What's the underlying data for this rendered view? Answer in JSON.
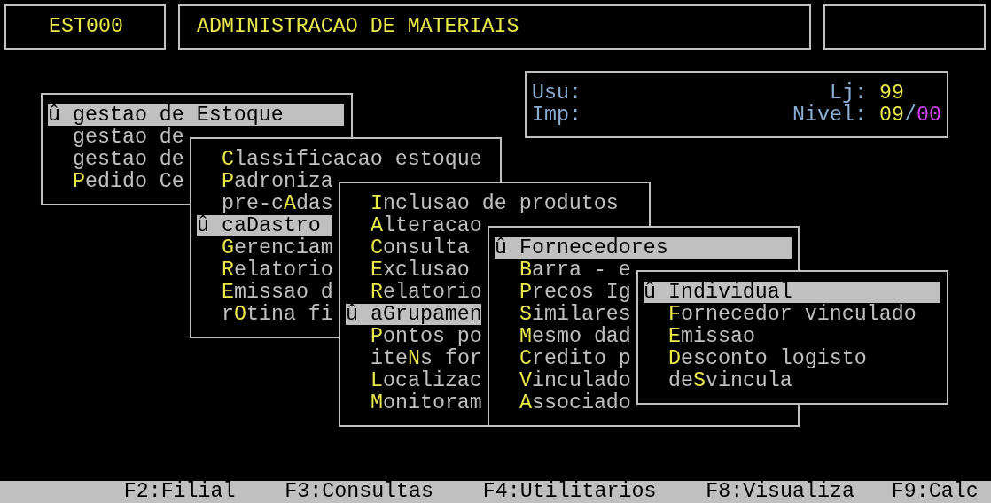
{
  "header": {
    "program_code": "EST000",
    "title": "ADMINISTRACAO DE MATERIAIS"
  },
  "info": {
    "rows": [
      {
        "label": "Usu:",
        "side_label": "Lj:",
        "value": [
          {
            "text": "99",
            "color": "#e8e84a"
          }
        ]
      },
      {
        "label": "Imp:",
        "side_label": "Nivel:",
        "value": [
          {
            "text": "09",
            "color": "#e8e84a"
          },
          {
            "text": "/",
            "color": "#8aaed6"
          },
          {
            "text": "00",
            "color": "#d040f0"
          }
        ]
      }
    ]
  },
  "menus": [
    {
      "items": [
        {
          "label": "gestao de Estoque",
          "selected": true,
          "marker": "û"
        },
        {
          "label": "gestao de",
          "selected": false
        },
        {
          "label": "gestao de",
          "selected": false
        },
        {
          "label": "**P**edido Ce",
          "selected": false
        }
      ]
    },
    {
      "items": [
        {
          "label": "**C**lassificacao estoque",
          "selected": false
        },
        {
          "label": "**P**adroniza",
          "selected": false
        },
        {
          "label": "pre-c**A**das",
          "selected": false
        },
        {
          "label": "caDastro",
          "selected": true,
          "marker": "û"
        },
        {
          "label": "**G**erenciam",
          "selected": false
        },
        {
          "label": "**R**elatorio",
          "selected": false
        },
        {
          "label": "**E**missao d",
          "selected": false
        },
        {
          "label": "r**O**tina fi",
          "selected": false
        }
      ]
    },
    {
      "items": [
        {
          "label": "**I**nclusao de produtos",
          "selected": false
        },
        {
          "label": "**A**lteracao",
          "selected": false
        },
        {
          "label": "**C**onsulta",
          "selected": false
        },
        {
          "label": "**E**xclusao",
          "selected": false
        },
        {
          "label": "**R**elatorio",
          "selected": false
        },
        {
          "label": "aGrupamen",
          "selected": true,
          "marker": "û"
        },
        {
          "label": "**P**ontos po",
          "selected": false
        },
        {
          "label": "ite**N**s for",
          "selected": false
        },
        {
          "label": "**L**ocalizac",
          "selected": false
        },
        {
          "label": "**M**onitoram",
          "selected": false
        }
      ]
    },
    {
      "items": [
        {
          "label": "Fornecedores",
          "selected": true,
          "marker": "û"
        },
        {
          "label": "**B**arra - e",
          "selected": false
        },
        {
          "label": "**P**recos Ig",
          "selected": false
        },
        {
          "label": "**S**imilares",
          "selected": false
        },
        {
          "label": "**M**esmo dad",
          "selected": false
        },
        {
          "label": "**C**redito p",
          "selected": false
        },
        {
          "label": "**V**inculado",
          "selected": false
        },
        {
          "label": "**A**ssociado",
          "selected": false
        }
      ]
    },
    {
      "items": [
        {
          "label": "Individual",
          "selected": true,
          "marker": "û"
        },
        {
          "label": "**F**ornecedor vinculado",
          "selected": false
        },
        {
          "label": "**E**missao",
          "selected": false
        },
        {
          "label": "**D**esconto logisto",
          "selected": false
        },
        {
          "label": "de**S**vincula",
          "selected": false
        }
      ]
    }
  ],
  "function_keys": [
    "F2:Filial",
    "F3:Consultas",
    "F4:Utilitarios",
    "F8:Visualiza",
    "F9:Calc"
  ]
}
